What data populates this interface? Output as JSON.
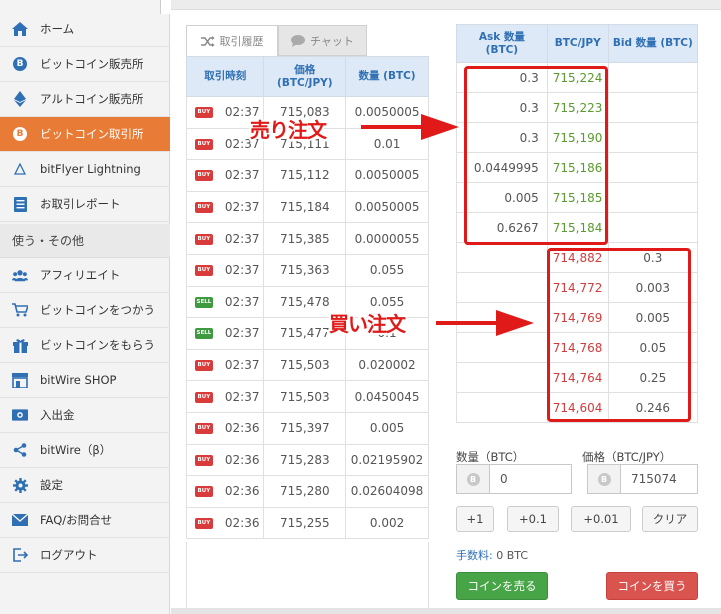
{
  "sidebar": {
    "items": [
      {
        "label": "ホーム",
        "icon": "home-icon"
      },
      {
        "label": "ビットコイン販売所",
        "icon": "bitcoin-icon"
      },
      {
        "label": "アルトコイン販売所",
        "icon": "ethereum-icon"
      },
      {
        "label": "ビットコイン取引所",
        "icon": "bitcoin-icon",
        "active": true
      },
      {
        "label": "bitFlyer Lightning",
        "icon": "lightning-triangle-icon"
      },
      {
        "label": "お取引レポート",
        "icon": "report-icon"
      }
    ],
    "section": "使う・その他",
    "items2": [
      {
        "label": "アフィリエイト",
        "icon": "users-icon"
      },
      {
        "label": "ビットコインをつかう",
        "icon": "cart-icon"
      },
      {
        "label": "ビットコインをもらう",
        "icon": "gift-icon"
      },
      {
        "label": "bitWire SHOP",
        "icon": "shop-icon"
      },
      {
        "label": "入出金",
        "icon": "money-icon"
      },
      {
        "label": "bitWire（β）",
        "icon": "share-icon"
      },
      {
        "label": "設定",
        "icon": "gear-icon"
      },
      {
        "label": "FAQ/お問合せ",
        "icon": "mail-icon"
      },
      {
        "label": "ログアウト",
        "icon": "logout-icon"
      }
    ]
  },
  "tabs": {
    "history": "取引履歴",
    "chat": "チャット"
  },
  "history": {
    "headers": {
      "time": "取引時刻",
      "price": "価格\n(BTC/JPY)",
      "qty": "数量 (BTC)"
    },
    "rows": [
      {
        "side": "BUY",
        "time": "02:37",
        "price": "715,083",
        "qty": "0.0050005"
      },
      {
        "side": "BUY",
        "time": "02:37",
        "price": "715,111",
        "qty": "0.01"
      },
      {
        "side": "BUY",
        "time": "02:37",
        "price": "715,112",
        "qty": "0.0050005"
      },
      {
        "side": "BUY",
        "time": "02:37",
        "price": "715,184",
        "qty": "0.0050005"
      },
      {
        "side": "BUY",
        "time": "02:37",
        "price": "715,385",
        "qty": "0.0000055"
      },
      {
        "side": "BUY",
        "time": "02:37",
        "price": "715,363",
        "qty": "0.055"
      },
      {
        "side": "SELL",
        "time": "02:37",
        "price": "715,478",
        "qty": "0.055"
      },
      {
        "side": "SELL",
        "time": "02:37",
        "price": "715,477",
        "qty": "0.1"
      },
      {
        "side": "BUY",
        "time": "02:37",
        "price": "715,503",
        "qty": "0.020002"
      },
      {
        "side": "BUY",
        "time": "02:37",
        "price": "715,503",
        "qty": "0.0450045"
      },
      {
        "side": "BUY",
        "time": "02:36",
        "price": "715,397",
        "qty": "0.005"
      },
      {
        "side": "BUY",
        "time": "02:36",
        "price": "715,283",
        "qty": "0.02195902"
      },
      {
        "side": "BUY",
        "time": "02:36",
        "price": "715,280",
        "qty": "0.02604098"
      },
      {
        "side": "BUY",
        "time": "02:36",
        "price": "715,255",
        "qty": "0.002"
      }
    ]
  },
  "book": {
    "headers": {
      "ask": "Ask 数量\n(BTC)",
      "price": "BTC/JPY",
      "bid": "Bid 数量 (BTC)"
    },
    "asks": [
      {
        "size": "0.3",
        "price": "715,224"
      },
      {
        "size": "0.3",
        "price": "715,223"
      },
      {
        "size": "0.3",
        "price": "715,190"
      },
      {
        "size": "0.0449995",
        "price": "715,186"
      },
      {
        "size": "0.005",
        "price": "715,185"
      },
      {
        "size": "0.6267",
        "price": "715,184"
      }
    ],
    "bids": [
      {
        "price": "714,882",
        "size": "0.3"
      },
      {
        "price": "714,772",
        "size": "0.003"
      },
      {
        "price": "714,769",
        "size": "0.005"
      },
      {
        "price": "714,768",
        "size": "0.05"
      },
      {
        "price": "714,764",
        "size": "0.25"
      },
      {
        "price": "714,604",
        "size": "0.246"
      }
    ]
  },
  "annotations": {
    "sell": "売り注文",
    "buy": "買い注文"
  },
  "form": {
    "qty_label": "数量（BTC）",
    "qty_value": "0",
    "price_label": "価格（BTC/JPY）",
    "price_value": "715074",
    "btn_p1": "+1",
    "btn_p01": "+0.1",
    "btn_p001": "+0.01",
    "btn_clear": "クリア",
    "fee_label": "手数料:",
    "fee_value": "0 BTC",
    "sell": "コインを売る",
    "buy": "コインを買う"
  },
  "colors": {
    "accent": "#e87c36",
    "ask_price": "#5a9a2e",
    "bid_price": "#d23b3b",
    "annotation": "#e01919"
  }
}
